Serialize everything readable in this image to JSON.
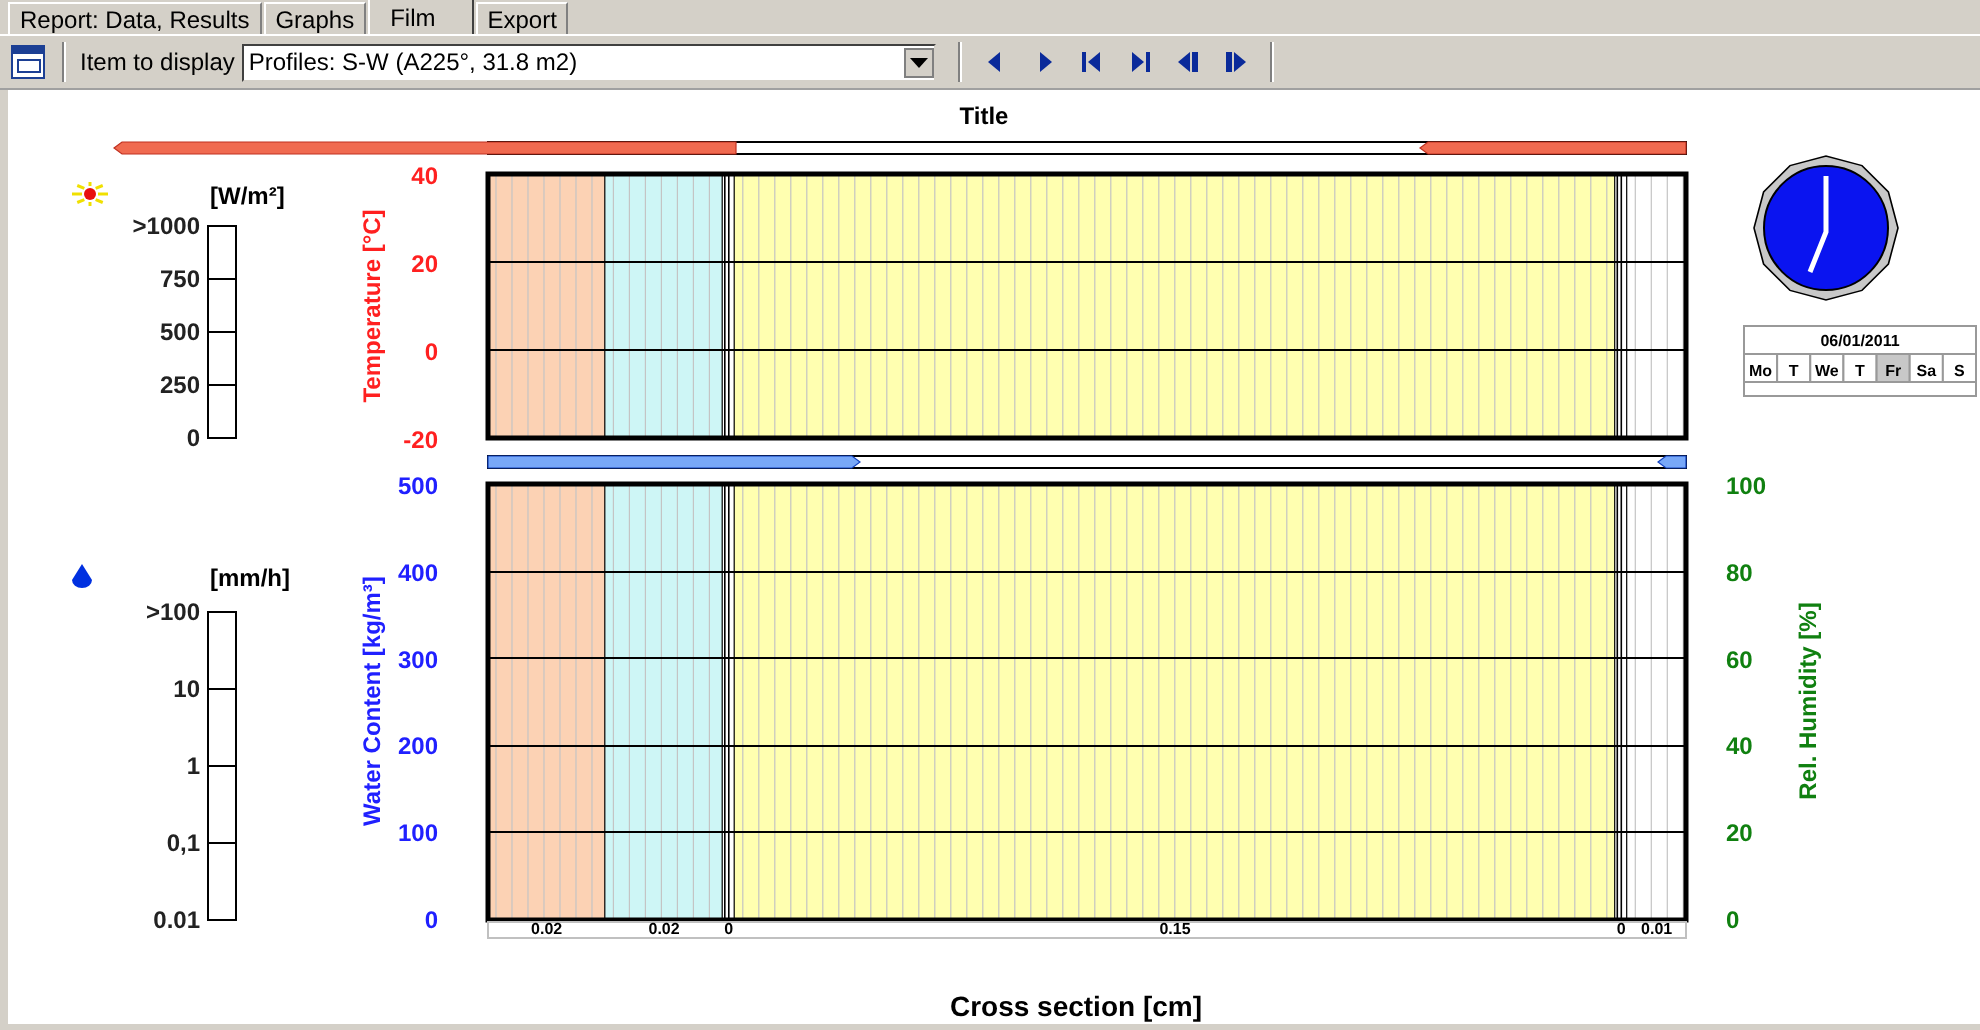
{
  "tabs": [
    {
      "label": "Report: Data, Results",
      "selected": false
    },
    {
      "label": "Graphs",
      "selected": false
    },
    {
      "label": "Film",
      "selected": true
    },
    {
      "label": "Export",
      "selected": false
    }
  ],
  "toolbar": {
    "item_label": "Item to display",
    "item_value": "Profiles: S-W (A225°, 31.8 m2)"
  },
  "chart_title": "Title",
  "radiation": {
    "unit": "[W/m²]",
    "ticks": [
      ">1000",
      "750",
      "500",
      "250",
      "0"
    ]
  },
  "rain": {
    "unit": "[mm/h]",
    "ticks": [
      ">100",
      "10",
      "1",
      "0,1",
      "0.01"
    ]
  },
  "temperature_axis": {
    "title": "Temperature [°C]",
    "ticks": [
      "40",
      "20",
      "0",
      "-20"
    ]
  },
  "water_axis": {
    "title": "Water Content [kg/m³]",
    "ticks": [
      "500",
      "400",
      "300",
      "200",
      "100",
      "0"
    ]
  },
  "humidity_axis": {
    "title": "Rel. Humidity [%]",
    "ticks": [
      "100",
      "80",
      "60",
      "40",
      "20",
      "0"
    ]
  },
  "layers": [
    {
      "thickness": "0.02",
      "kind": "material",
      "color": "#fcd2b4"
    },
    {
      "thickness": "0.02",
      "kind": "material",
      "color": "#cef6f6"
    },
    {
      "thickness": "0",
      "kind": "membrane",
      "color": "#ffffff"
    },
    {
      "thickness": "0.15",
      "kind": "material",
      "color": "#ffffb0"
    },
    {
      "thickness": "0",
      "kind": "membrane",
      "color": "#ffffff"
    },
    {
      "thickness": "0.01",
      "kind": "material",
      "color": "#ffffff"
    }
  ],
  "x_axis_title": "Cross section [cm]",
  "calendar": {
    "date": "06/01/2011",
    "days": [
      {
        "label": "Mo",
        "selected": false
      },
      {
        "label": "T",
        "selected": false
      },
      {
        "label": "We",
        "selected": false
      },
      {
        "label": "T",
        "selected": false
      },
      {
        "label": "Fr",
        "selected": true
      },
      {
        "label": "Sa",
        "selected": false
      },
      {
        "label": "S",
        "selected": false
      }
    ]
  }
}
